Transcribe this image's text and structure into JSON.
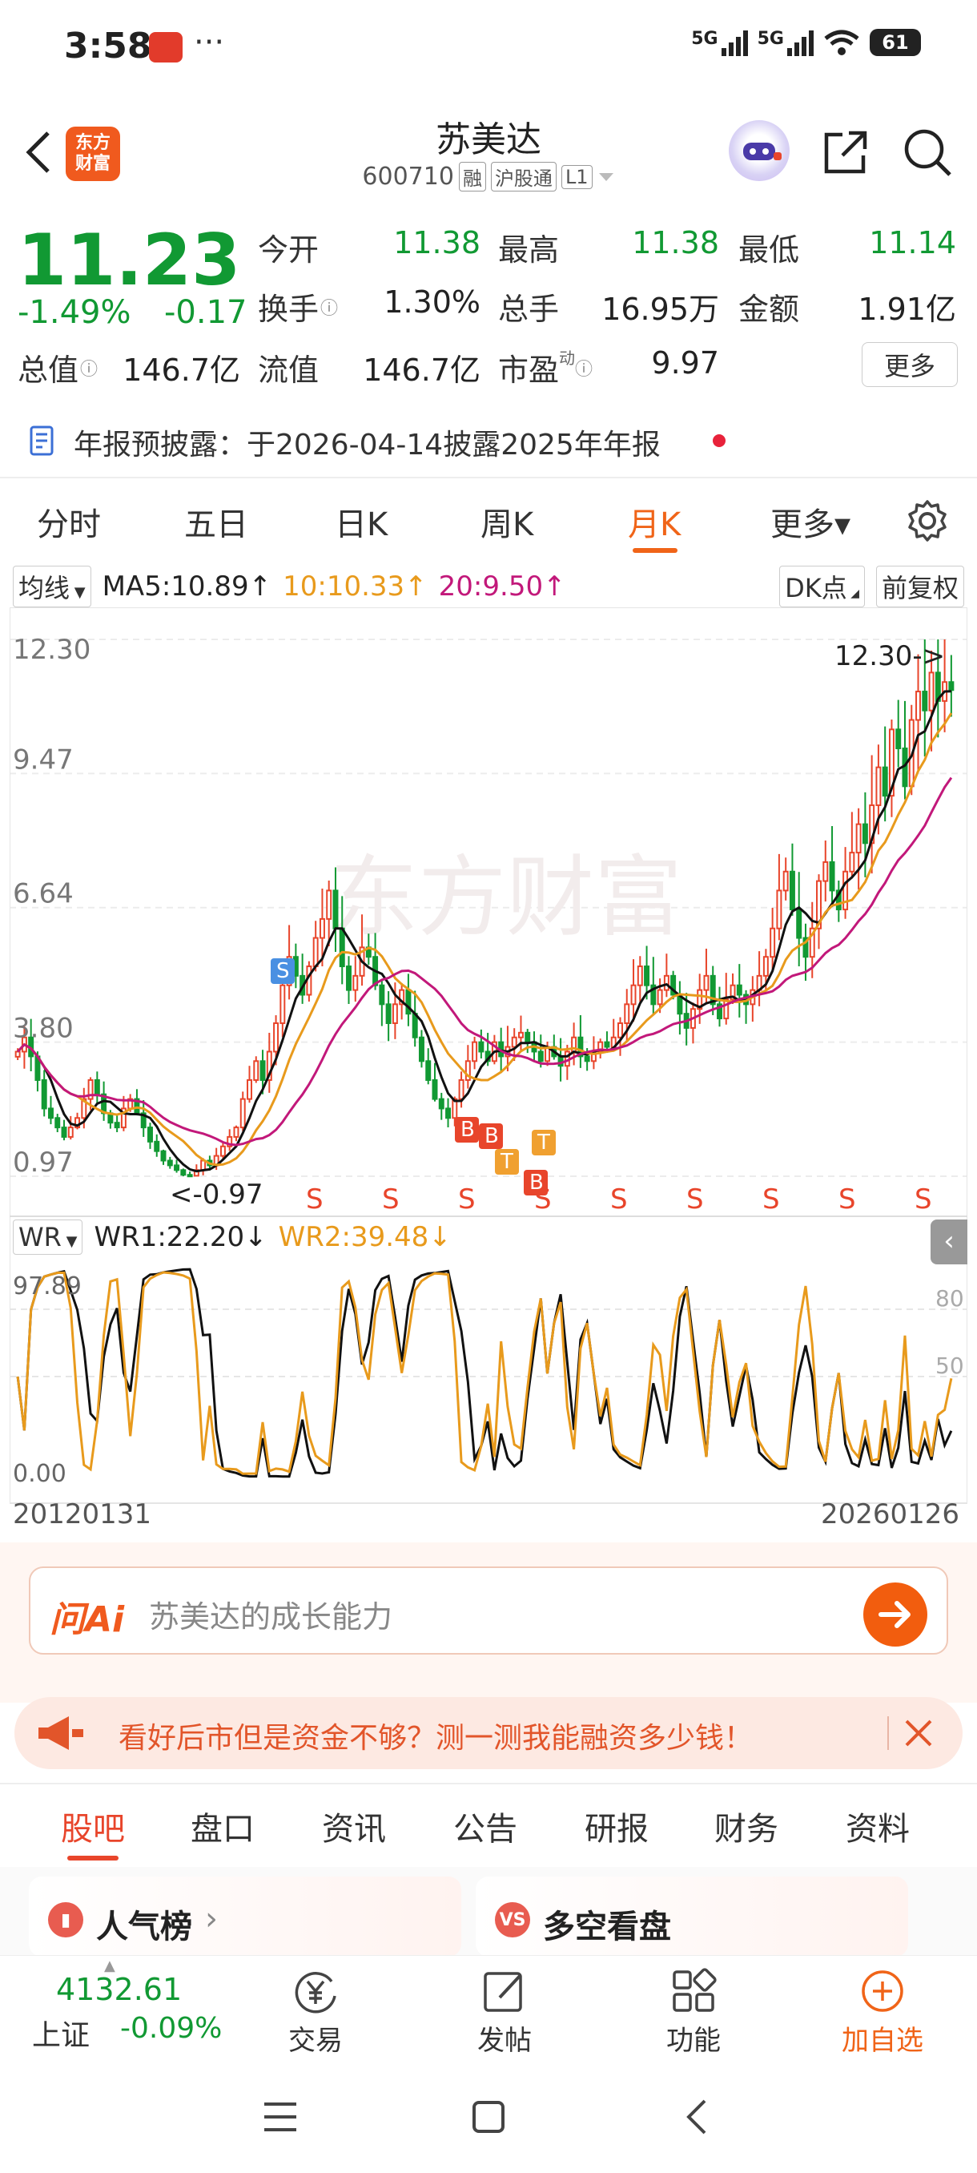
{
  "status": {
    "time": "3:58",
    "dots": "···",
    "signal1": "5G",
    "signal2": "5G",
    "battery": "61"
  },
  "header": {
    "logo_line1": "东方",
    "logo_line2": "财富",
    "stock_name": "苏美达",
    "stock_code": "600710",
    "tag_margin": "融",
    "tag_connect": "沪股通",
    "tag_level": "L1"
  },
  "quote": {
    "price": "11.23",
    "pct": "-1.49%",
    "change": "-0.17",
    "open_label": "今开",
    "open": "11.38",
    "high_label": "最高",
    "high": "11.38",
    "low_label": "最低",
    "low": "11.14",
    "turnover_label": "换手",
    "turnover": "1.30%",
    "volume_label": "总手",
    "volume": "16.95万",
    "amount_label": "金额",
    "amount": "1.91亿",
    "mktcap_label": "总值",
    "mktcap": "146.7亿",
    "float_label": "流值",
    "float": "146.7亿",
    "pe_label": "市盈",
    "pe_sup": "动",
    "pe": "9.97",
    "more": "更多"
  },
  "notice": {
    "text": "年报预披露：于2026-04-14披露2025年年报"
  },
  "period_tabs": [
    "分时",
    "五日",
    "日K",
    "周K",
    "月K",
    "更多▾"
  ],
  "ma_bar": {
    "selector": "均线",
    "ma5": "MA5:10.89↑",
    "ma10": "10:10.33↑",
    "ma20": "20:9.50↑",
    "dk": "DK点",
    "adjust": "前复权"
  },
  "chart_data": {
    "type": "candlestick",
    "period": "monthly",
    "x_start": "20120131",
    "x_end": "20260126",
    "y_ticks": [
      "12.30",
      "9.47",
      "6.64",
      "3.80",
      "0.97"
    ],
    "ylim": [
      0.97,
      12.3
    ],
    "max_label": "12.30->",
    "min_label": "<-0.97",
    "closes": [
      3.6,
      3.9,
      3.5,
      3.0,
      2.4,
      2.2,
      2.0,
      1.8,
      2.0,
      2.2,
      2.6,
      3.0,
      2.7,
      2.3,
      2.1,
      2.0,
      2.4,
      2.6,
      2.3,
      2.0,
      1.7,
      1.5,
      1.3,
      1.2,
      1.1,
      1.0,
      0.98,
      1.1,
      1.3,
      1.2,
      1.4,
      1.6,
      1.8,
      2.0,
      2.6,
      3.0,
      3.4,
      3.0,
      3.6,
      4.2,
      5.0,
      5.6,
      5.2,
      4.8,
      5.4,
      6.0,
      6.4,
      7.0,
      6.2,
      5.4,
      4.9,
      5.2,
      5.8,
      5.6,
      5.0,
      4.6,
      4.2,
      4.6,
      4.9,
      4.4,
      3.9,
      3.4,
      3.0,
      2.6,
      2.4,
      2.2,
      2.6,
      3.0,
      3.4,
      3.8,
      3.6,
      3.4,
      3.8,
      3.5,
      3.7,
      3.9,
      4.0,
      3.8,
      3.6,
      3.4,
      3.7,
      3.5,
      3.3,
      3.6,
      3.9,
      3.5,
      3.4,
      3.6,
      3.8,
      3.7,
      3.9,
      4.2,
      4.6,
      5.0,
      5.4,
      5.0,
      4.6,
      4.9,
      5.2,
      4.8,
      4.4,
      4.1,
      4.5,
      4.9,
      5.2,
      4.6,
      4.3,
      4.7,
      5.0,
      4.8,
      4.6,
      4.9,
      5.2,
      5.6,
      6.2,
      7.0,
      7.4,
      6.6,
      6.0,
      5.6,
      6.2,
      7.2,
      7.6,
      7.0,
      6.6,
      7.4,
      7.8,
      8.4,
      8.0,
      8.8,
      9.6,
      9.0,
      10.4,
      10.0,
      9.2,
      10.6,
      11.2,
      10.8,
      11.6,
      11.0,
      11.4,
      11.23
    ],
    "ma_series": [
      "MA5",
      "MA10",
      "MA20"
    ],
    "signals": {
      "S_markers": 9,
      "labels": [
        "S",
        "B",
        "B",
        "T",
        "T",
        "B"
      ]
    }
  },
  "wr_bar": {
    "selector": "WR",
    "wr1": "WR1:22.20↓",
    "wr2": "WR2:39.48↓",
    "top_value": "97.89",
    "bottom_value": "0.00",
    "right_80": "80",
    "right_50": "50"
  },
  "ai": {
    "logo": "问Ai",
    "placeholder": "苏美达的成长能力"
  },
  "promo": {
    "text": "看好后市但是资金不够？测一测我能融资多少钱！"
  },
  "info_tabs": [
    "股吧",
    "盘口",
    "资讯",
    "公告",
    "研报",
    "财务",
    "资料"
  ],
  "cards": {
    "hot": "人气榜",
    "hot_arrow": "›",
    "bull_bear": "多空看盘"
  },
  "bottom_nav": {
    "index_value": "4132.61",
    "index_name": "上证",
    "index_pct": "-0.09%",
    "trade": "交易",
    "post": "发帖",
    "func": "功能",
    "add": "加自选"
  },
  "colors": {
    "up": "#e8452b",
    "down": "#119933",
    "accent": "#f06418",
    "ma5": "#111111",
    "ma10": "#e89a1c",
    "ma20": "#c2187a"
  }
}
